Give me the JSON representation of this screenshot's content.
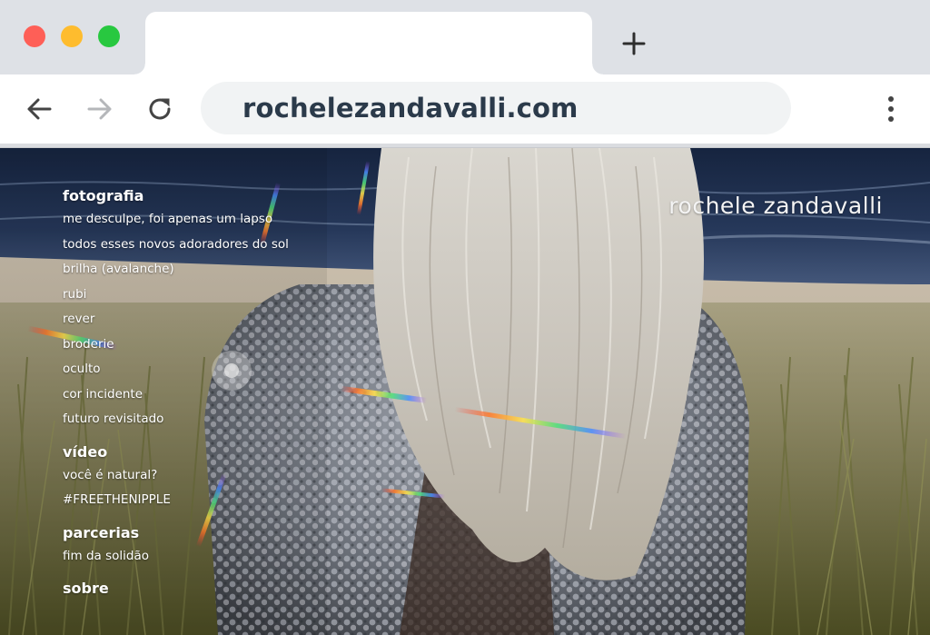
{
  "browser": {
    "url": "rochelezandavalli.com",
    "icons": {
      "window_close": "close-circle",
      "window_minimize": "minimize-circle",
      "window_maximize": "maximize-circle",
      "new_tab": "plus-icon",
      "back": "arrow-left-icon",
      "forward": "arrow-right-icon",
      "reload": "reload-icon",
      "menu": "kebab-menu-icon"
    },
    "colors": {
      "tabbar": "#dee1e6",
      "omnibox": "#f1f3f4",
      "url_text": "#2b3a4a",
      "traffic_red": "#fe5f57",
      "traffic_yellow": "#febc2e",
      "traffic_green": "#28c840"
    }
  },
  "site": {
    "title": "rochele zandavalli",
    "nav": {
      "fotografia": {
        "heading": "fotografia",
        "items": [
          "me desculpe, foi apenas um lapso",
          "todos esses novos adoradores do sol",
          "brilha (avalanche)",
          "rubi",
          "rever",
          "broderie",
          "oculto",
          "cor incidente",
          "futuro revisitado"
        ]
      },
      "video": {
        "heading": "vídeo",
        "items": [
          "você é natural?",
          "#FREETHENIPPLE"
        ]
      },
      "parcerias": {
        "heading": "parcerias",
        "items": [
          "fim da solidão"
        ]
      },
      "sobre": {
        "heading": "sobre"
      }
    }
  }
}
